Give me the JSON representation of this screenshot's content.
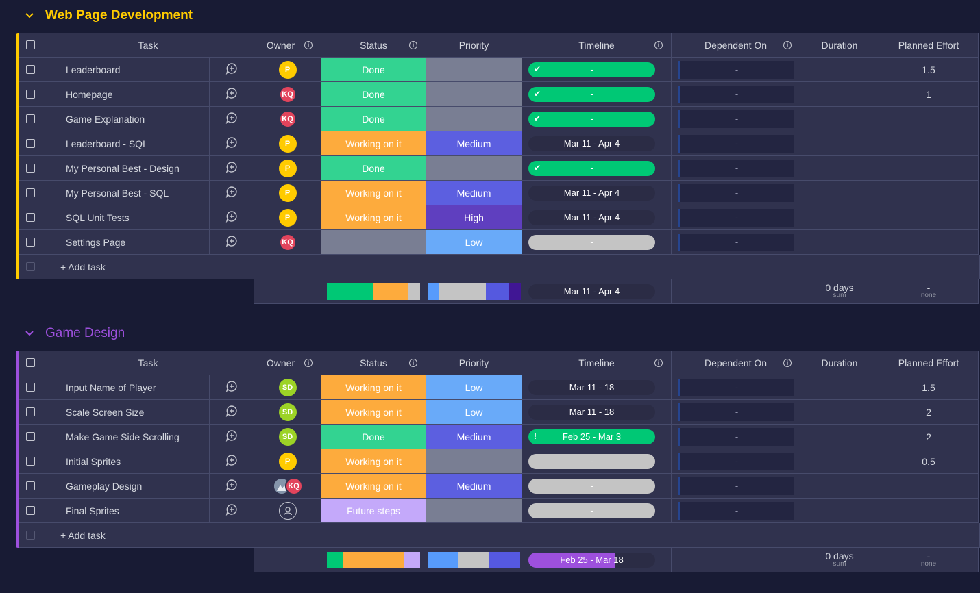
{
  "columns": {
    "task": "Task",
    "owner": "Owner",
    "status": "Status",
    "priority": "Priority",
    "timeline": "Timeline",
    "dependent_on": "Dependent On",
    "duration": "Duration",
    "planned_effort": "Planned Effort"
  },
  "colors": {
    "done": "#33d391",
    "working": "#fdab3d",
    "future": "#c4a9fa",
    "blank": "#797e93",
    "medium": "#5c5fe0",
    "high": "#5f3fbf",
    "low": "#69aaf9",
    "timeline_done": "#00c875",
    "timeline_dark": "#2b2c45",
    "timeline_empty": "#c4c4c4"
  },
  "groups": [
    {
      "title": "Web Page Development",
      "color": "#ffcb00",
      "add_task": "+ Add task",
      "rows": [
        {
          "task": "Leaderboard",
          "owner": "P",
          "status": "Done",
          "priority": "",
          "timeline": "-",
          "timeline_kind": "done-check",
          "dep": "-",
          "duration": "",
          "effort": "1.5"
        },
        {
          "task": "Homepage",
          "owner": "KQ",
          "status": "Done",
          "priority": "",
          "timeline": "-",
          "timeline_kind": "done-check",
          "dep": "-",
          "duration": "",
          "effort": "1"
        },
        {
          "task": "Game Explanation",
          "owner": "KQ",
          "status": "Done",
          "priority": "",
          "timeline": "-",
          "timeline_kind": "done-check",
          "dep": "-",
          "duration": "",
          "effort": ""
        },
        {
          "task": "Leaderboard - SQL",
          "owner": "P",
          "status": "Working on it",
          "priority": "Medium",
          "timeline": "Mar 11 - Apr 4",
          "timeline_kind": "dark",
          "dep": "-",
          "duration": "",
          "effort": ""
        },
        {
          "task": "My Personal Best - Design",
          "owner": "P",
          "status": "Done",
          "priority": "",
          "timeline": "-",
          "timeline_kind": "done-check",
          "dep": "-",
          "duration": "",
          "effort": ""
        },
        {
          "task": "My Personal Best - SQL",
          "owner": "P",
          "status": "Working on it",
          "priority": "Medium",
          "timeline": "Mar 11 - Apr 4",
          "timeline_kind": "dark",
          "dep": "-",
          "duration": "",
          "effort": ""
        },
        {
          "task": "SQL Unit Tests",
          "owner": "P",
          "status": "Working on it",
          "priority": "High",
          "timeline": "Mar 11 - Apr 4",
          "timeline_kind": "dark",
          "dep": "-",
          "duration": "",
          "effort": ""
        },
        {
          "task": "Settings Page",
          "owner": "KQ",
          "status": "",
          "priority": "Low",
          "timeline": "-",
          "timeline_kind": "empty",
          "dep": "-",
          "duration": "",
          "effort": ""
        }
      ],
      "summary": {
        "timeline": "Mar 11 - Apr 4",
        "duration_value": "0 days",
        "duration_label": "sum",
        "effort_value": "-",
        "effort_label": "none",
        "status_dist": [
          {
            "color": "#00c875",
            "pct": 50
          },
          {
            "color": "#fdab3d",
            "pct": 37.5
          },
          {
            "color": "#c4c4c4",
            "pct": 12.5
          }
        ],
        "priority_dist": [
          {
            "color": "#579bfc",
            "pct": 12.5
          },
          {
            "color": "#c4c4c4",
            "pct": 50
          },
          {
            "color": "#5559df",
            "pct": 25
          },
          {
            "color": "#401694",
            "pct": 12.5
          }
        ]
      }
    },
    {
      "title": "Game Design",
      "color": "#9d50dd",
      "add_task": "+ Add task",
      "rows": [
        {
          "task": "Input Name of Player",
          "owner": "SD",
          "status": "Working on it",
          "priority": "Low",
          "timeline": "Mar 11 - 18",
          "timeline_kind": "dark",
          "dep": "-",
          "duration": "",
          "effort": "1.5"
        },
        {
          "task": "Scale Screen Size",
          "owner": "SD",
          "status": "Working on it",
          "priority": "Low",
          "timeline": "Mar 11 - 18",
          "timeline_kind": "dark",
          "dep": "-",
          "duration": "",
          "effort": "2"
        },
        {
          "task": "Make Game Side Scrolling",
          "owner": "SD",
          "status": "Done",
          "priority": "Medium",
          "timeline": "Feb 25 - Mar 3",
          "timeline_kind": "done-alert",
          "dep": "-",
          "duration": "",
          "effort": "2"
        },
        {
          "task": "Initial Sprites",
          "owner": "P",
          "status": "Working on it",
          "priority": "",
          "timeline": "-",
          "timeline_kind": "empty",
          "dep": "-",
          "duration": "",
          "effort": "0.5"
        },
        {
          "task": "Gameplay Design",
          "owner": "PHOTO+KQ",
          "status": "Working on it",
          "priority": "Medium",
          "timeline": "-",
          "timeline_kind": "empty",
          "dep": "-",
          "duration": "",
          "effort": ""
        },
        {
          "task": "Final Sprites",
          "owner": "EMPTY",
          "status": "Future steps",
          "priority": "",
          "timeline": "-",
          "timeline_kind": "empty",
          "dep": "-",
          "duration": "",
          "effort": ""
        }
      ],
      "summary": {
        "timeline": "Feb 25 - Mar 18",
        "duration_value": "0 days",
        "duration_label": "sum",
        "effort_value": "-",
        "effort_label": "none",
        "status_dist": [
          {
            "color": "#00c875",
            "pct": 16.7
          },
          {
            "color": "#fdab3d",
            "pct": 66.6
          },
          {
            "color": "#c4a9fa",
            "pct": 16.7
          }
        ],
        "priority_dist": [
          {
            "color": "#579bfc",
            "pct": 33.3
          },
          {
            "color": "#c4c4c4",
            "pct": 33.3
          },
          {
            "color": "#5559df",
            "pct": 33.4
          }
        ]
      }
    }
  ]
}
